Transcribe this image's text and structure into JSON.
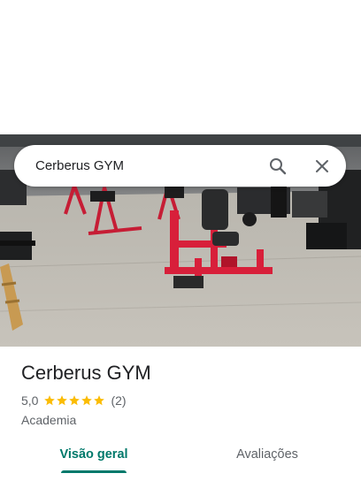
{
  "search": {
    "query": "Cerberus GYM"
  },
  "place": {
    "name": "Cerberus GYM",
    "rating": "5,0",
    "stars_filled": 5,
    "review_count": "(2)",
    "category": "Academia"
  },
  "tabs": [
    {
      "label": "Visão geral",
      "selected": true
    },
    {
      "label": "Avaliações",
      "selected": false
    }
  ],
  "colors": {
    "accent": "#00796b",
    "star": "#fbbc04",
    "machine": "#d81f3a"
  },
  "icons": {
    "search": "search-icon",
    "close": "close-icon",
    "star": "star-icon"
  }
}
